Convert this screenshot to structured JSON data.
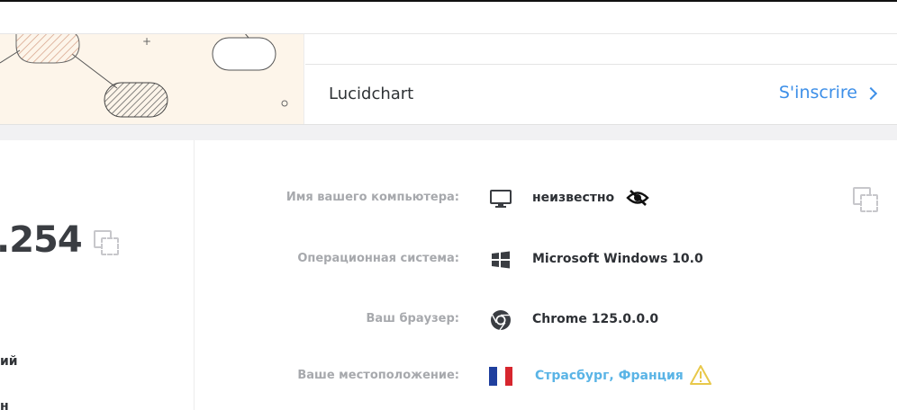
{
  "ad": {
    "brand": "Lucidchart",
    "cta_label": "S'inscrire",
    "cta_color": "#3d8fe8"
  },
  "left": {
    "ip_fragment": ".254",
    "text_fragment_1": "ий",
    "text_fragment_2": "н"
  },
  "info": {
    "rows": [
      {
        "label": "Имя вашего компьютера:",
        "icon": "monitor-icon",
        "value": "неизвестно",
        "extra_icon": "eye-slash-icon"
      },
      {
        "label": "Операционная система:",
        "icon": "windows-icon",
        "value": "Microsoft Windows 10.0"
      },
      {
        "label": "Ваш браузер:",
        "icon": "chrome-icon",
        "value": "Chrome 125.0.0.0"
      },
      {
        "label": "Ваше местоположение:",
        "icon": "france-flag-icon",
        "value": "Страсбург, Франция",
        "extra_icon": "warning-icon"
      }
    ]
  },
  "colors": {
    "label": "#a7a9ad",
    "value": "#2d3035",
    "location_link": "#5ab4e6",
    "warning": "#e8c84a"
  }
}
